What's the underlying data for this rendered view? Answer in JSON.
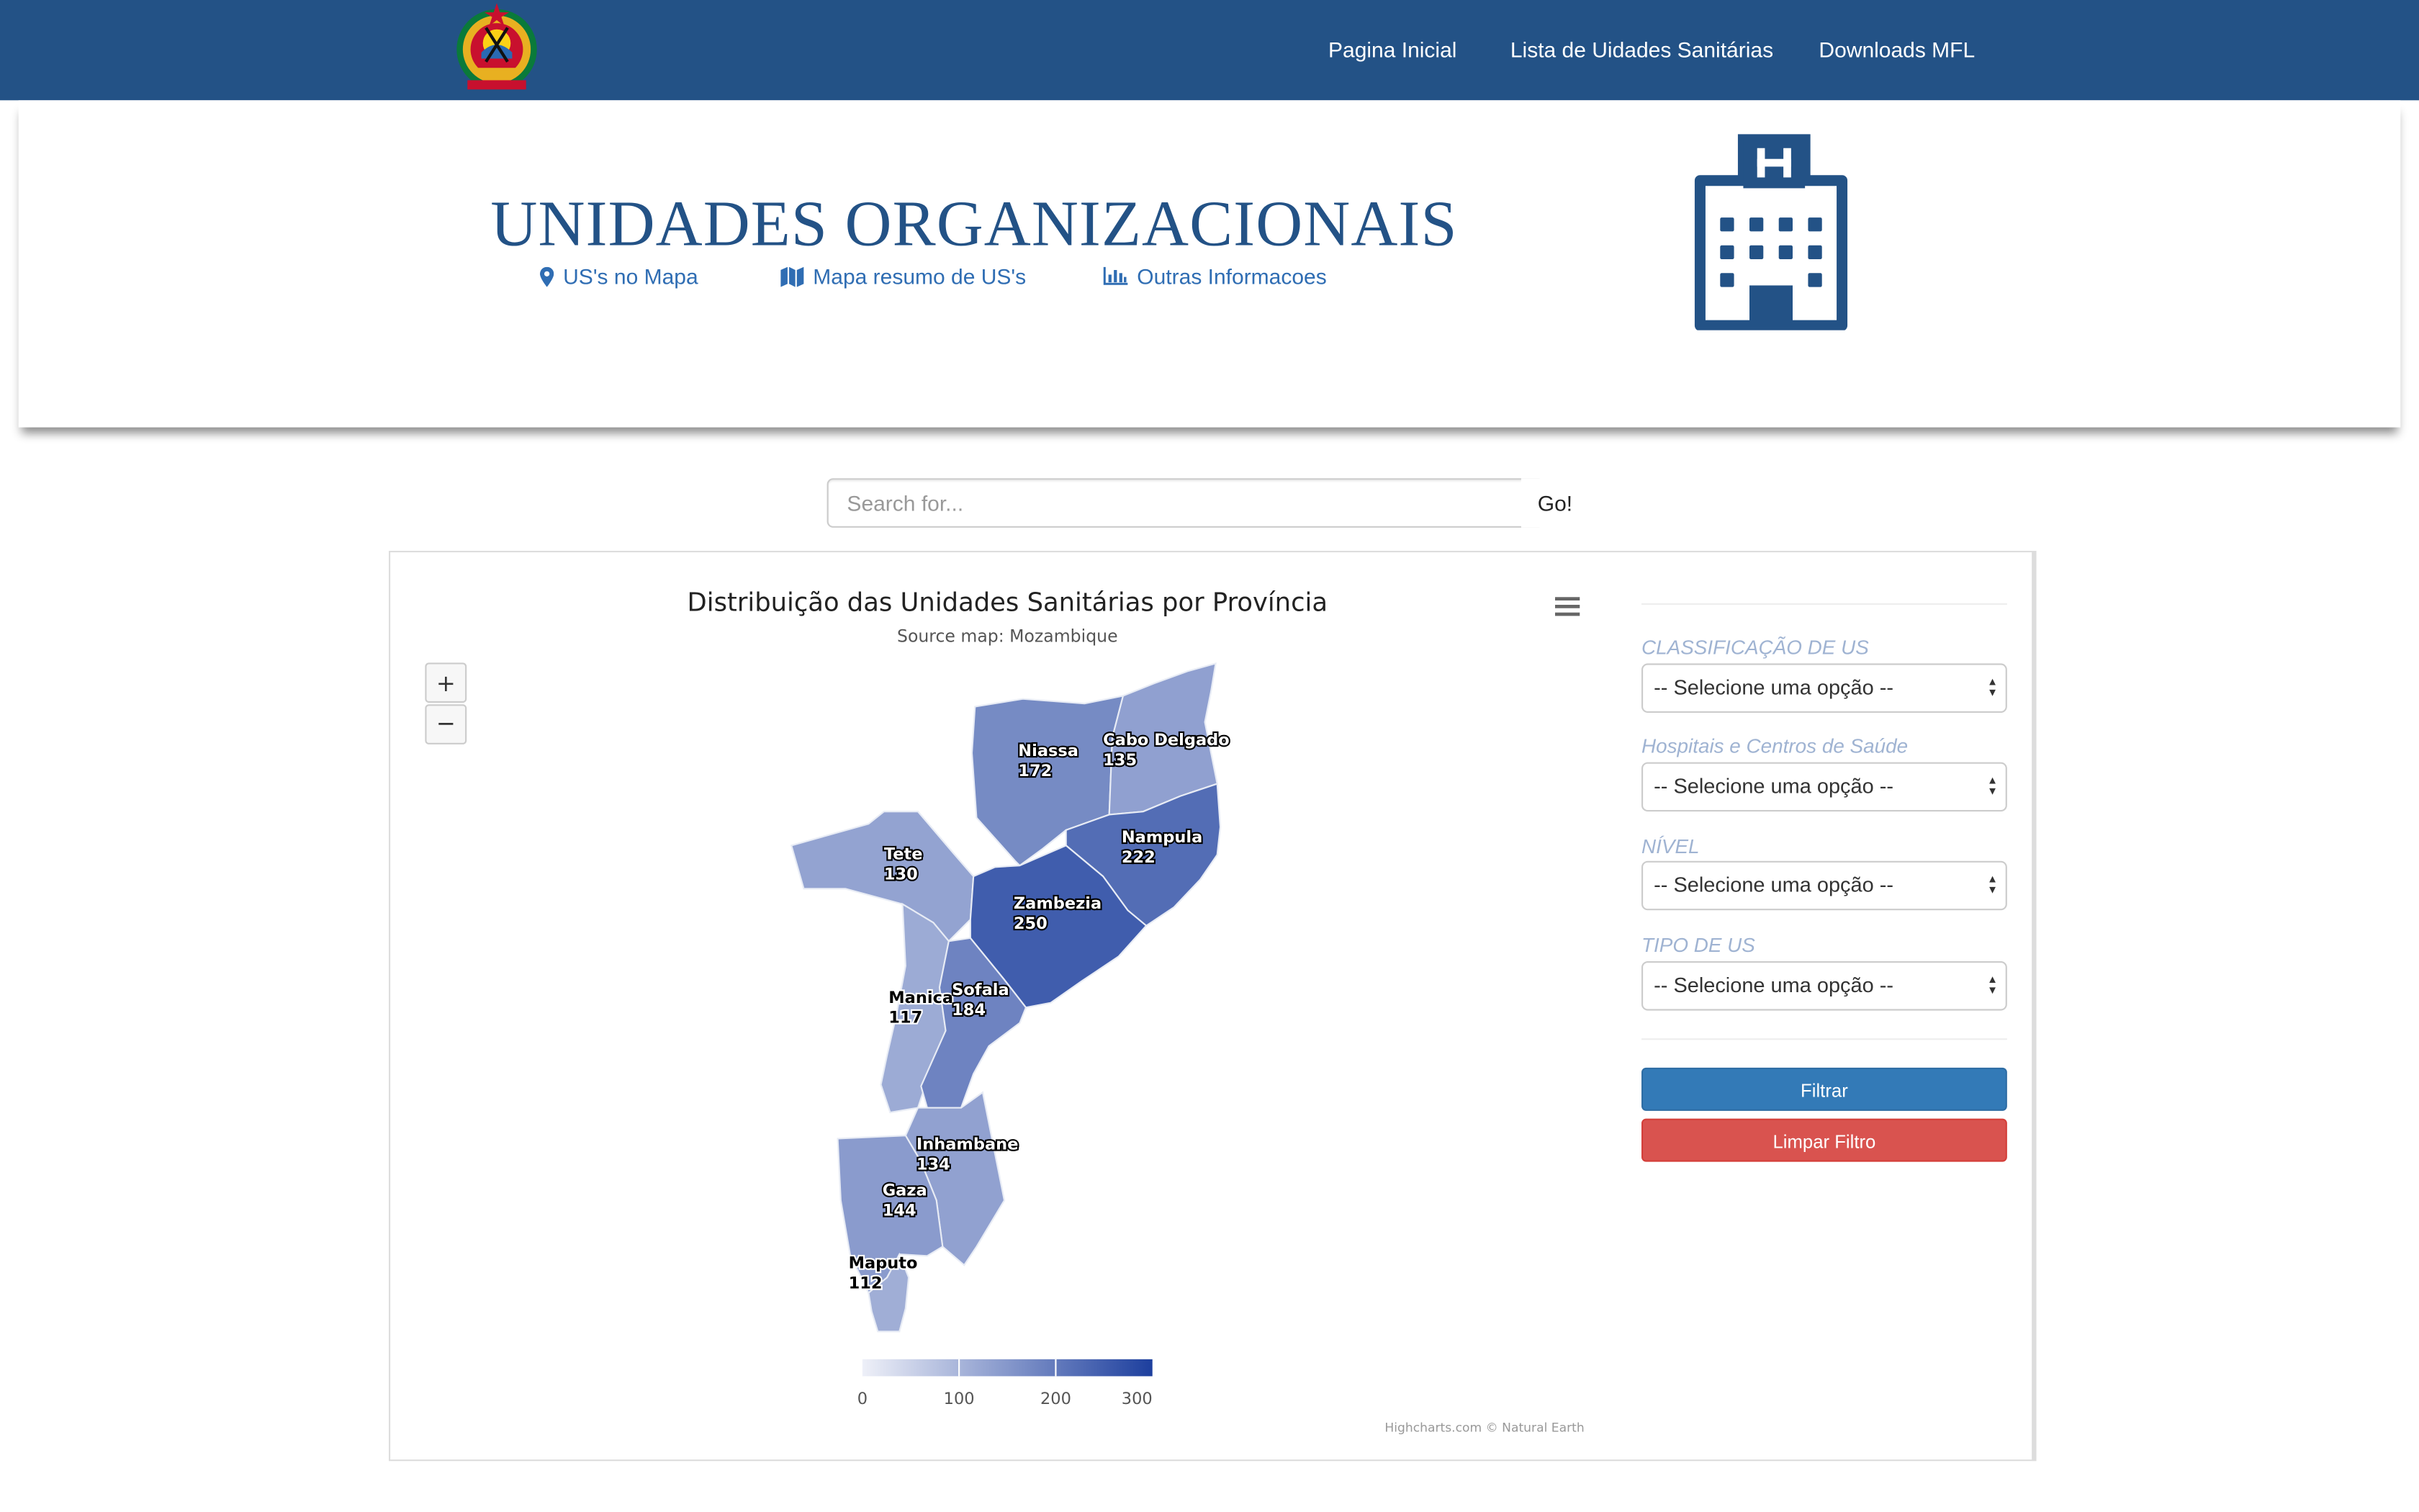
{
  "navbar": {
    "links": [
      "Pagina Inicial",
      "Lista de Uidades Sanitárias",
      "Downloads MFL"
    ],
    "background": "#235286"
  },
  "hero": {
    "title": "UNIDADES ORGANIZACIONAIS",
    "links": [
      {
        "icon": "map-marker-icon",
        "label": "US's no Mapa"
      },
      {
        "icon": "map-icon",
        "label": "Mapa resumo de US's"
      },
      {
        "icon": "bar-chart-icon",
        "label": "Outras Informacoes"
      }
    ],
    "image_icon": "hospital-building-icon"
  },
  "search": {
    "placeholder": "Search for...",
    "button": "Go!"
  },
  "chart": {
    "title": "Distribuição das Unidades Sanitárias por Província",
    "subtitle": "Source map: Mozambique",
    "zoom_in": "+",
    "zoom_out": "−",
    "credits": "Highcharts.com © Natural Earth"
  },
  "chart_data": {
    "type": "choropleth-map",
    "title": "Distribuição das Unidades Sanitárias por Província",
    "subtitle": "Source map: Mozambique",
    "regions": [
      {
        "name": "Niassa",
        "value": 172
      },
      {
        "name": "Cabo Delgado",
        "value": 135
      },
      {
        "name": "Nampula",
        "value": 222
      },
      {
        "name": "Tete",
        "value": 130
      },
      {
        "name": "Zambezia",
        "value": 250
      },
      {
        "name": "Manica",
        "value": 117
      },
      {
        "name": "Sofala",
        "value": 184
      },
      {
        "name": "Inhambane",
        "value": 134
      },
      {
        "name": "Gaza",
        "value": 144
      },
      {
        "name": "Maputo",
        "value": 112
      }
    ],
    "color_axis": {
      "min": 0,
      "max": 300,
      "ticks": [
        0,
        100,
        200,
        300
      ],
      "min_color": "#eef0f8",
      "max_color": "#1d3f9e"
    }
  },
  "filters": {
    "fields": [
      {
        "label": "CLASSIFICAÇÃO DE US",
        "value": "-- Selecione uma opção --"
      },
      {
        "label": "Hospitais e Centros de Saúde",
        "value": "-- Selecione uma opção --"
      },
      {
        "label": "NÍVEL",
        "value": "-- Selecione uma opção --"
      },
      {
        "label": "TIPO DE US",
        "value": "-- Selecione uma opção --"
      }
    ],
    "filter_button": "Filtrar",
    "clear_button": "Limpar Filtro",
    "primary_color": "#337ab7",
    "danger_color": "#d9534f"
  }
}
